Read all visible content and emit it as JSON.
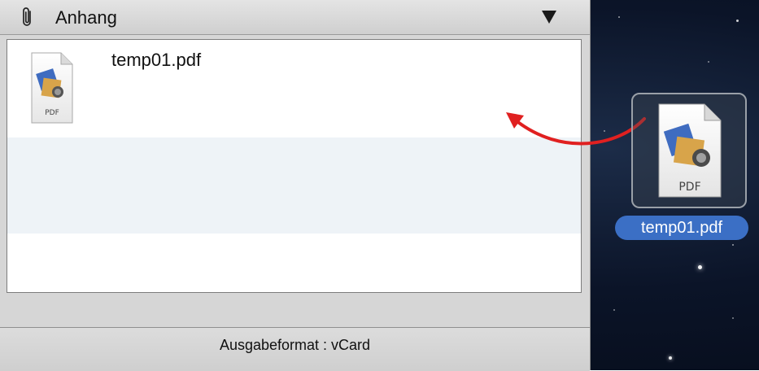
{
  "attachments_panel": {
    "title": "Anhang",
    "items": [
      {
        "name": "temp01.pdf",
        "icon_label": "PDF"
      }
    ]
  },
  "footer": {
    "label": "Ausgabeformat : vCard"
  },
  "desktop": {
    "file_name": "temp01.pdf",
    "icon_label": "PDF"
  },
  "colors": {
    "drag_arrow": "#e02020",
    "selection_label": "#3b6fc5"
  }
}
